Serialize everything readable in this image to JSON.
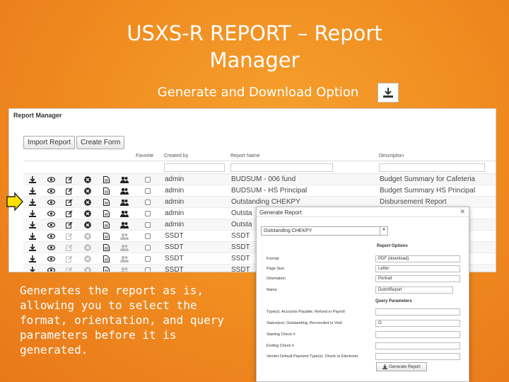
{
  "slide": {
    "title": "USXS-R REPORT – Report Manager",
    "subtitle": "Generate and Download Option",
    "description": "Generates the report as is, allowing you to select the format, orientation, and query parameters before it is generated."
  },
  "colors": {
    "background": "#ef8a1f",
    "arrow": "#ffe000"
  },
  "report_manager": {
    "title": "Report Manager",
    "buttons": {
      "import": "Import Report",
      "create": "Create Form"
    },
    "columns": {
      "favorite": "Favorite",
      "created_by": "Created by",
      "report_name": "Report Name",
      "description": "Description"
    },
    "rows": [
      {
        "created_by": "admin",
        "report_name": "BUDSUM - 006 fund",
        "description": "Budget Summary for Cafeteria"
      },
      {
        "created_by": "admin",
        "report_name": "BUDSUM - HS Principal",
        "description": "Budget Summary HS Principal"
      },
      {
        "created_by": "admin",
        "report_name": "Outstanding CHEKPY",
        "description": "Disbursement Report"
      },
      {
        "created_by": "admin",
        "report_name": "Outsta",
        "description": ""
      },
      {
        "created_by": "admin",
        "report_name": "Outsta",
        "description": ""
      },
      {
        "created_by": "SSDT",
        "report_name": "SSDT",
        "description": ""
      },
      {
        "created_by": "SSDT",
        "report_name": "SSDT",
        "description": ""
      },
      {
        "created_by": "SSDT",
        "report_name": "SSDT",
        "description": ""
      },
      {
        "created_by": "SSDT",
        "report_name": "SSDT",
        "description": ""
      }
    ]
  },
  "generate_dialog": {
    "title": "Generate Report",
    "selected_report": "Outstanding CHEKPY",
    "options_header": "Report Options",
    "format_label": "Format",
    "format_value": "PDF (download)",
    "page_size_label": "Page Size",
    "page_size_value": "Letter",
    "orientation_label": "Orientation",
    "orientation_value": "Portrait",
    "name_label": "Name",
    "name_value": "DutchReport",
    "query_header": "Query Parameters",
    "params": [
      {
        "label": "Type(s): Accounts Payable, Refund or Payroll",
        "value": ""
      },
      {
        "label": "Status(es): Outstanding, Reconciled or Void",
        "value": "O"
      },
      {
        "label": "Starting Check #",
        "value": ""
      },
      {
        "label": "Ending Check #",
        "value": ""
      },
      {
        "label": "Vendor Default Payment Type(s): Check or Electronic",
        "value": ""
      }
    ],
    "generate_label": "Generate Report"
  }
}
